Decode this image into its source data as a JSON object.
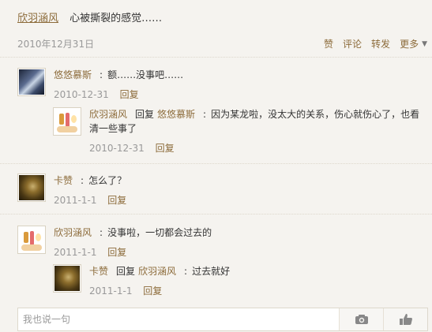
{
  "post": {
    "author": "欣羽涵风",
    "content": "心被撕裂的感觉……",
    "date": "2010年12月31日"
  },
  "actions": {
    "like": "赞",
    "comment": "评论",
    "forward": "转发",
    "more": "更多"
  },
  "comments": [
    {
      "author": "悠悠慕斯",
      "text": "额……没事吧……",
      "date": "2010-12-31",
      "reply": "回复"
    },
    {
      "author": "欣羽涵风",
      "reply_word": "回复",
      "target": "悠悠慕斯",
      "text": "因为某龙啦，没太大的关系，伤心就伤心了，也看",
      "text2": "清一些事了",
      "date": "2010-12-31",
      "reply": "回复"
    },
    {
      "author": "卡赞",
      "text": "怎么了？",
      "date": "2011-1-1",
      "reply": "回复"
    },
    {
      "author": "欣羽涵风",
      "text": "没事啦，一切都会过去的",
      "date": "2011-1-1",
      "reply": "回复"
    },
    {
      "author": "卡赞",
      "reply_word": "回复",
      "target": "欣羽涵风",
      "text": "过去就好",
      "date": "2011-1-1",
      "reply": "回复"
    }
  ],
  "input": {
    "placeholder": "我也说一句"
  },
  "icons": {
    "camera": "camera-icon",
    "send": "thumb-icon",
    "more": "caret-down-icon"
  },
  "colors": {
    "link": "#8c6b3a",
    "meta": "#999999",
    "background": "#f5f3ef"
  }
}
